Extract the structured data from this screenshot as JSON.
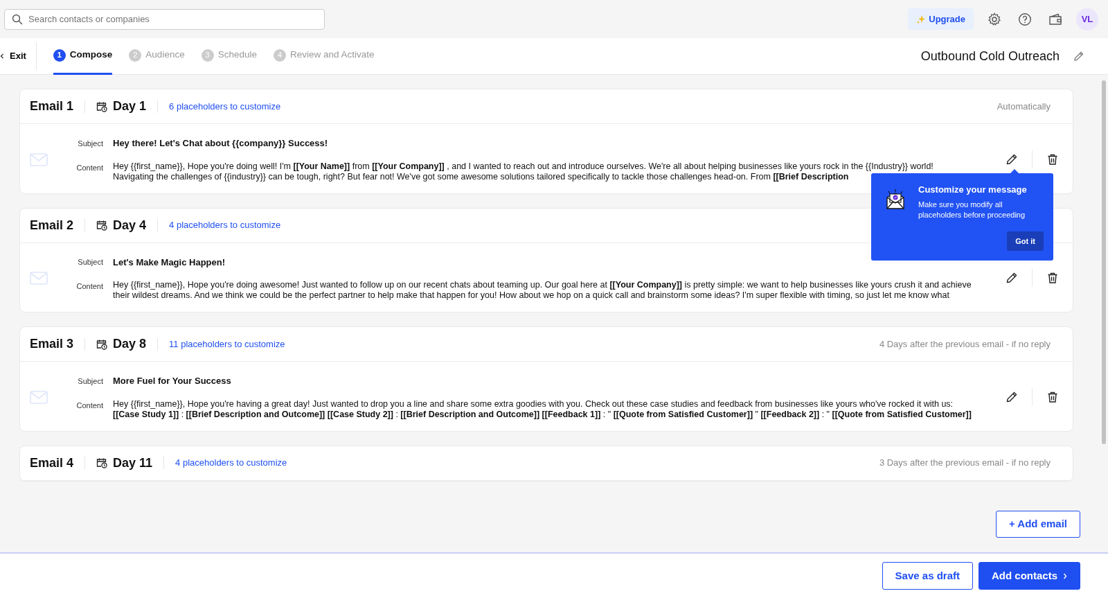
{
  "search": {
    "placeholder": "Search contacts or companies"
  },
  "header_actions": {
    "upgrade": "Upgrade",
    "avatar": "VL"
  },
  "nav": {
    "exit": "Exit",
    "campaign_title": "Outbound Cold Outreach",
    "steps": [
      {
        "number": "1",
        "label": "Compose",
        "selected": true
      },
      {
        "number": "2",
        "label": "Audience",
        "selected": false
      },
      {
        "number": "3",
        "label": "Schedule",
        "selected": false
      },
      {
        "number": "4",
        "label": "Review and Activate",
        "selected": false
      }
    ]
  },
  "emails": [
    {
      "title": "Email 1",
      "day": "Day 1",
      "placeholders": "6 placeholders to customize",
      "schedule": "Automatically",
      "subject_label": "Subject",
      "subject": "Hey there! Let's Chat about {{company}} Success!",
      "content_label": "Content",
      "content": "Hey {{first_name}}, Hope you're doing well! I'm **[[Your Name]]** from **[[Your Company]]** , and I wanted to reach out and introduce ourselves. We're all about helping businesses like yours rock in the {{Industry}} world!\nNavigating the challenges of {{industry}} can be tough, right? But fear not! We've got some awesome solutions tailored specifically to tackle those challenges head-on. From **[[Brief Description**"
    },
    {
      "title": "Email 2",
      "day": "Day 4",
      "placeholders": "4 placeholders to customize",
      "subject_label": "Subject",
      "subject": "Let's Make Magic Happen!",
      "content_label": "Content",
      "content": "Hey {{first_name}}, Hope you're doing awesome! Just wanted to follow up on our recent chats about teaming up. Our goal here at **[[Your Company]]** is pretty simple: we want to help businesses like yours crush it and achieve\ntheir wildest dreams. And we think we could be the perfect partner to help make that happen for you! How about we hop on a quick call and brainstorm some ideas? I'm super flexible with timing, so just let me know what"
    },
    {
      "title": "Email 3",
      "day": "Day 8",
      "placeholders": "11 placeholders to customize",
      "schedule": "4 Days after the previous email - if no reply",
      "subject_label": "Subject",
      "subject": "More Fuel for Your Success",
      "content_label": "Content",
      "content": "Hey {{first_name}}, Hope you're having a great day! Just wanted to drop you a line and share some extra goodies with you. Check out these case studies and feedback from businesses like yours who've rocked it with us:\n**[[Case Study 1]]** : **[[Brief Description and Outcome]]** **[[Case Study 2]]** : **[[Brief Description and Outcome]]** **[[Feedback 1]]** : \" **[[Quote from Satisfied Customer]]** \" **[[Feedback 2]]** : \" **[[Quote from Satisfied Customer]]**"
    },
    {
      "title": "Email 4",
      "day": "Day 11",
      "placeholders": "4 placeholders to customize",
      "schedule": "3 Days after the previous email - if no reply"
    }
  ],
  "popover": {
    "title": "Customize your message",
    "text": "Make sure you modify all placeholders before proceeding",
    "button": "Got it"
  },
  "add_email": "+ Add email",
  "footer": {
    "save_draft": "Save as draft",
    "add_contacts": "Add contacts"
  }
}
